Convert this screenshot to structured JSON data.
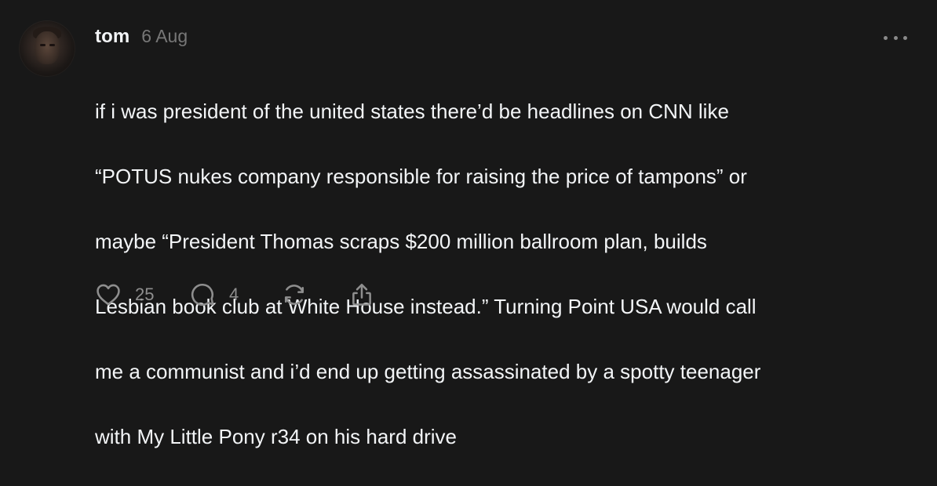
{
  "post": {
    "author": {
      "username": "tom",
      "avatar": "user-profile-photo"
    },
    "timestamp": "6 Aug",
    "text_lines": [
      "if i was president of the united states there’d be headlines on CNN like",
      "“POTUS nukes company responsible for raising the price of tampons” or",
      "maybe “President Thomas scraps $200 million ballroom plan, builds",
      "Lesbian book club at White House instead.” Turning Point USA would call",
      "me a communist and i’d end up getting assassinated by a spotty teenager",
      "with My Little Pony r34 on his hard drive"
    ],
    "actions": {
      "like": {
        "icon": "heart-icon",
        "count": "25"
      },
      "reply": {
        "icon": "comment-icon",
        "count": "4"
      },
      "repost": {
        "icon": "repost-icon"
      },
      "share": {
        "icon": "share-icon"
      }
    },
    "menu_icon": "more-icon"
  },
  "colors": {
    "background": "#181818",
    "primary_text": "#f3f5f7",
    "secondary_text": "#777777",
    "icon": "#8e8e8e"
  }
}
